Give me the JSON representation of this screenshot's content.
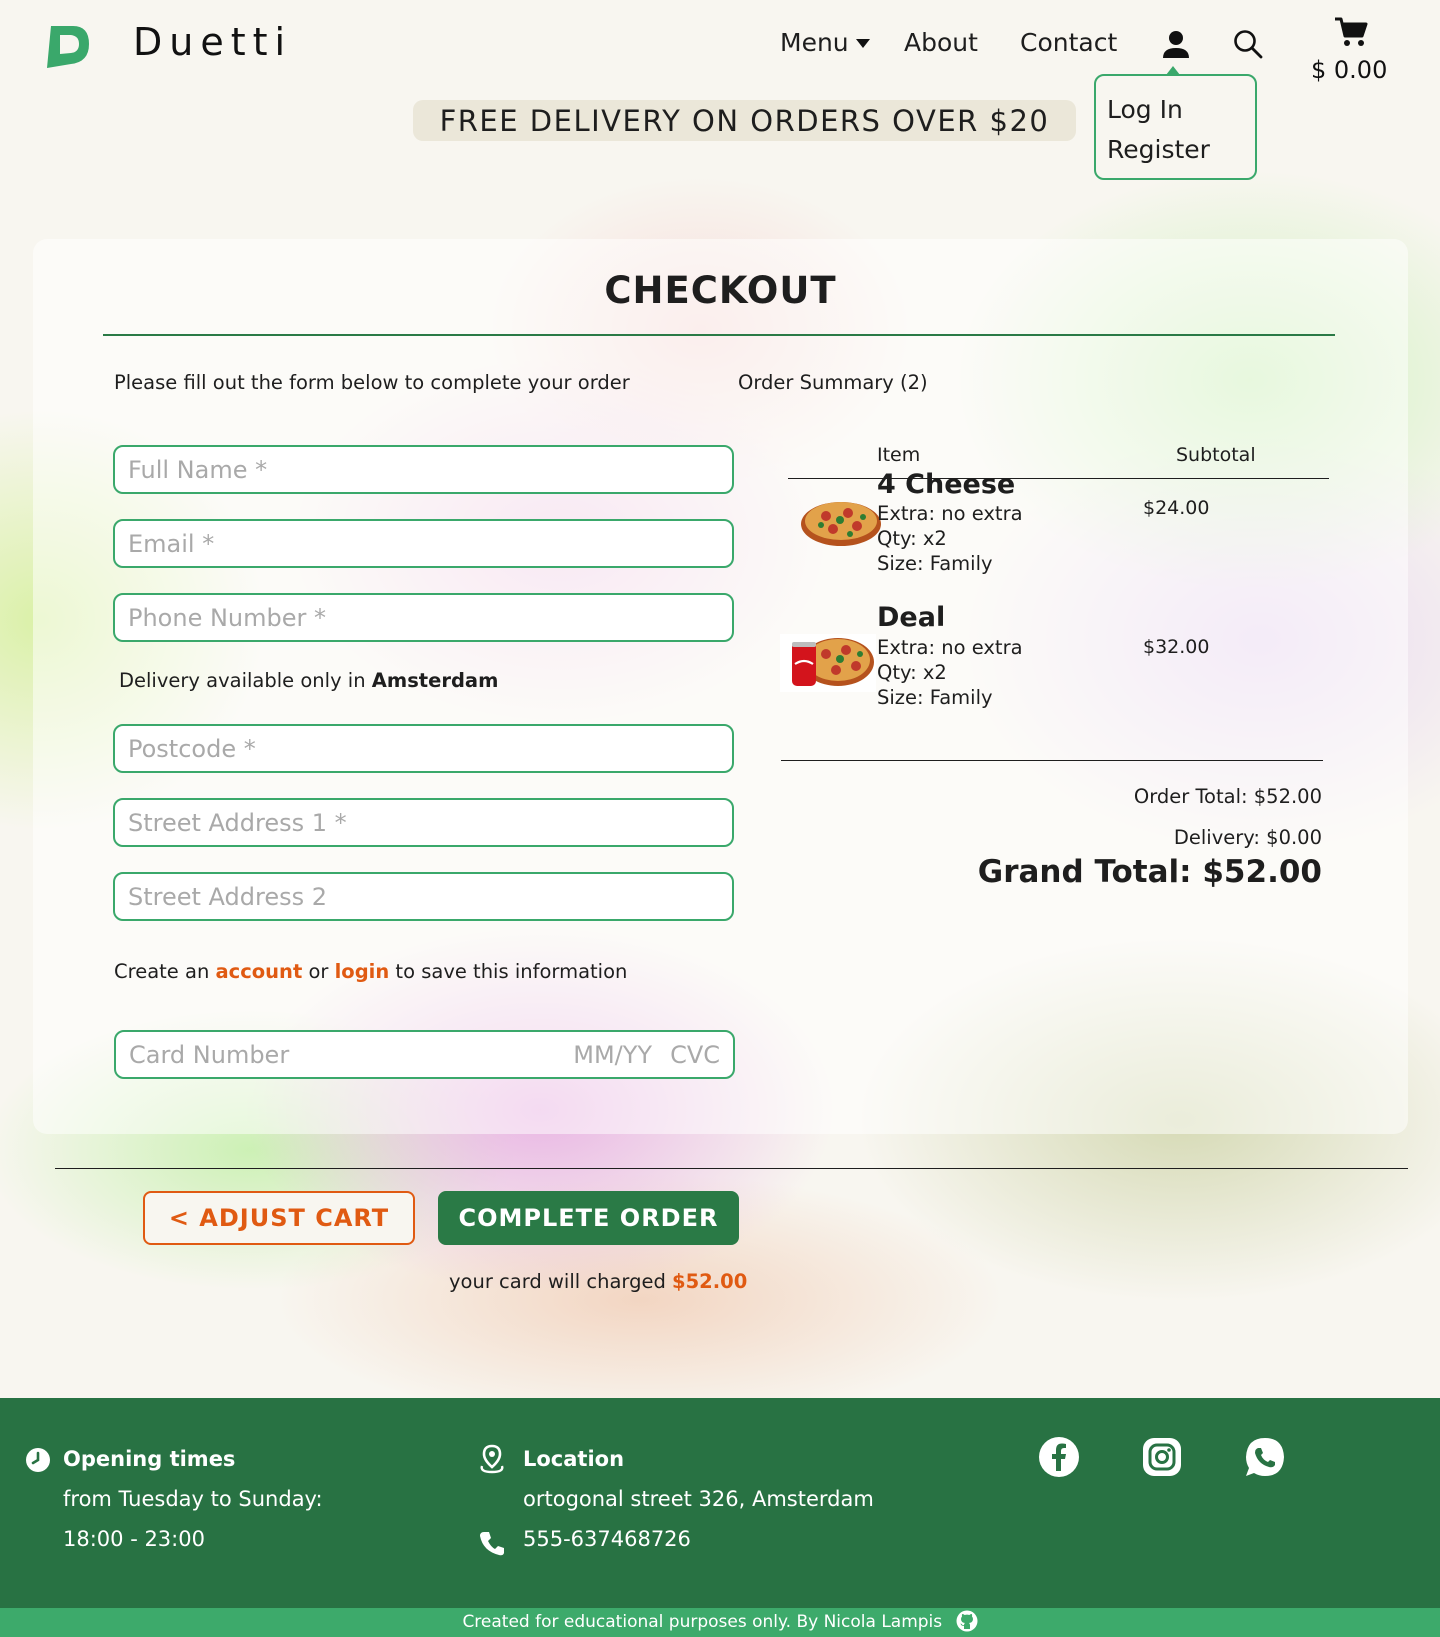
{
  "header": {
    "brand": "Duetti",
    "nav": {
      "menu": "Menu",
      "about": "About",
      "contact": "Contact"
    },
    "cart_total": "$ 0.00",
    "user_menu": {
      "login": "Log In",
      "register": "Register"
    },
    "promo": "FREE DELIVERY ON ORDERS OVER $20"
  },
  "checkout": {
    "title": "CHECKOUT",
    "intro": "Please fill out the form below to complete your order",
    "fields": {
      "full_name": "Full Name *",
      "email": "Email *",
      "phone": "Phone Number *",
      "postcode": "Postcode *",
      "street1": "Street Address 1 *",
      "street2": "Street Address 2"
    },
    "delivery_note": {
      "prefix": "Delivery available only in ",
      "city": "Amsterdam"
    },
    "account_note": {
      "prefix": "Create an ",
      "account_link": "account",
      "middle": " or ",
      "login_link": "login",
      "suffix": " to save this information"
    },
    "card": {
      "number": "Card Number",
      "expiry": "MM/YY",
      "cvc": "CVC"
    }
  },
  "summary": {
    "title": "Order Summary (2)",
    "col_item": "Item",
    "col_subtotal": "Subtotal",
    "items": [
      {
        "name": "4 Cheese",
        "extra": "Extra: no extra",
        "qty": "Qty: x2",
        "size": "Size: Family",
        "subtotal": "$24.00"
      },
      {
        "name": "Deal",
        "extra": "Extra: no extra",
        "qty": "Qty: x2",
        "size": "Size: Family",
        "subtotal": "$32.00"
      }
    ],
    "order_total": "Order Total: $52.00",
    "delivery": "Delivery: $0.00",
    "grand_total": "Grand Total: $52.00"
  },
  "actions": {
    "adjust": "<  ADJUST CART",
    "complete": "COMPLETE ORDER",
    "charge_prefix": "your card will charged ",
    "charge_amount": "$52.00"
  },
  "footer": {
    "opening_heading": "Opening times",
    "opening_days": "from Tuesday to Sunday:",
    "opening_hours": "18:00 - 23:00",
    "location_heading": "Location",
    "address": "ortogonal street 326, Amsterdam",
    "phone": "555-637468726",
    "credit": "Created for educational purposes only.  By Nicola Lampis"
  },
  "colors": {
    "brand_green": "#287243",
    "accent_green": "#3aa86b",
    "link_orange": "#e05a12"
  },
  "icons": [
    "logo-d",
    "user-icon",
    "search-icon",
    "cart-icon",
    "clock-icon",
    "location-icon",
    "phone-icon",
    "facebook-icon",
    "instagram-icon",
    "whatsapp-icon",
    "github-icon"
  ]
}
